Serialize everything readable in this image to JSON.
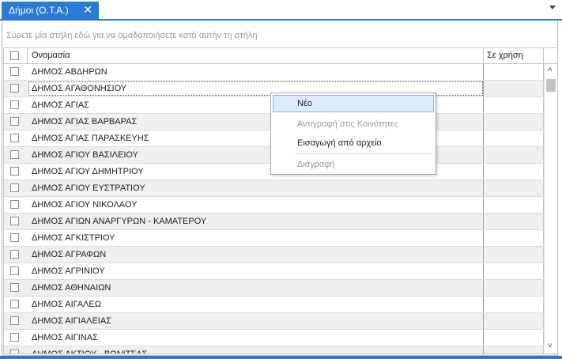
{
  "tab": {
    "title": "Δήμοι (Ο.Τ.Α.)",
    "close_glyph": "✕"
  },
  "group_panel": {
    "hint": "Σύρετε μία στήλη εδώ για να ομαδοποιήσετε κατά αυτήν τη στήλη"
  },
  "grid": {
    "columns": {
      "name": "Ονομασία",
      "in_use": "Σε χρήση"
    },
    "rows": [
      "ΔΗΜΟΣ ΑΒΔΗΡΩΝ",
      "ΔΗΜΟΣ ΑΓΑΘΟΝΗΣΙΟΥ",
      "ΔΗΜΟΣ ΑΓΙΑΣ",
      "ΔΗΜΟΣ ΑΓΙΑΣ ΒΑΡΒΑΡΑΣ",
      "ΔΗΜΟΣ ΑΓΙΑΣ ΠΑΡΑΣΚΕΥΗΣ",
      "ΔΗΜΟΣ ΑΓΙΟΥ ΒΑΣΙΛΕΙΟΥ",
      "ΔΗΜΟΣ ΑΓΙΟΥ ΔΗΜΗΤΡΙΟΥ",
      "ΔΗΜΟΣ ΑΓΙΟΥ ΕΥΣΤΡΑΤΙΟΥ",
      "ΔΗΜΟΣ ΑΓΙΟΥ ΝΙΚΟΛΑΟΥ",
      "ΔΗΜΟΣ ΑΓΙΩΝ ΑΝΑΡΓΥΡΩΝ - ΚΑΜΑΤΕΡΟΥ",
      "ΔΗΜΟΣ ΑΓΚΙΣΤΡΙΟΥ",
      "ΔΗΜΟΣ ΑΓΡΑΦΩΝ",
      "ΔΗΜΟΣ ΑΓΡΙΝΙΟΥ",
      "ΔΗΜΟΣ ΑΘΗΝΑΙΩΝ",
      "ΔΗΜΟΣ ΑΙΓΑΛΕΩ",
      "ΔΗΜΟΣ ΑΙΓΙΑΛΕΙΑΣ",
      "ΔΗΜΟΣ ΑΙΓΙΝΑΣ",
      "ΔΗΜΟΣ ΑΚΤΙΟΥ - ΒΟΝΙΤΣΑΣ"
    ],
    "focused_row_index": 1
  },
  "context_menu": {
    "items": [
      {
        "label": "Νέο",
        "enabled": true,
        "highlighted": true
      },
      {
        "label": "Αντιγραφή στις Κοινότητες",
        "enabled": false
      },
      {
        "label": "Εισαγωγή από αρχείο",
        "enabled": true
      },
      {
        "label": "Διαγραφή",
        "enabled": false
      }
    ]
  },
  "colors": {
    "accent": "#2b7bd6",
    "menu_highlight": "#dcebf9",
    "alt_row": "#efefef"
  }
}
